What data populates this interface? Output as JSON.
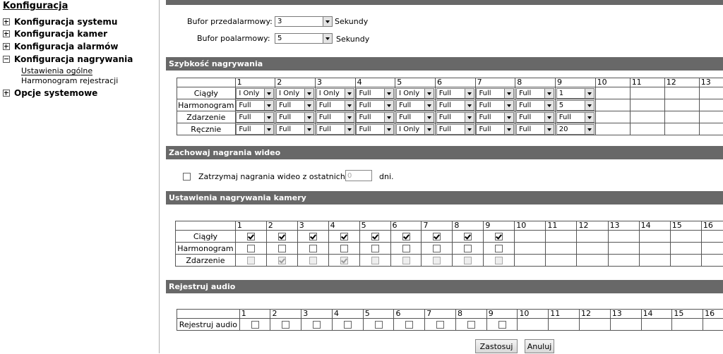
{
  "sidebar": {
    "title": "Konfiguracja",
    "items": [
      {
        "label": "Konfiguracja systemu",
        "expanded": false
      },
      {
        "label": "Konfiguracja kamer",
        "expanded": false
      },
      {
        "label": "Konfiguracja alarmów",
        "expanded": false
      },
      {
        "label": "Konfiguracja nagrywania",
        "expanded": true
      },
      {
        "label": "Opcje systemowe",
        "expanded": false
      }
    ],
    "subitems": [
      "Ustawienia ogólne",
      "Harmonogram rejestracji"
    ]
  },
  "buffer": {
    "pre_label": "Bufor przedalarmowy:",
    "pre_value": "3",
    "post_label": "Bufor poalarmowy:",
    "post_value": "5",
    "unit": "Sekundy"
  },
  "speed": {
    "header": "Szybkość nagrywania",
    "columns": [
      "1",
      "2",
      "3",
      "4",
      "5",
      "6",
      "7",
      "8",
      "9",
      "10",
      "11",
      "12",
      "13"
    ],
    "rows": [
      {
        "label": "Ciągły",
        "values": [
          "I Only",
          "I Only",
          "I Only",
          "Full",
          "I Only",
          "Full",
          "Full",
          "Full",
          "1"
        ]
      },
      {
        "label": "Harmonogram",
        "values": [
          "Full",
          "Full",
          "Full",
          "Full",
          "Full",
          "Full",
          "Full",
          "Full",
          "5"
        ]
      },
      {
        "label": "Zdarzenie",
        "values": [
          "Full",
          "Full",
          "Full",
          "Full",
          "Full",
          "Full",
          "Full",
          "Full",
          "Full"
        ]
      },
      {
        "label": "Ręcznie",
        "values": [
          "Full",
          "Full",
          "Full",
          "Full",
          "I Only",
          "Full",
          "Full",
          "Full",
          "20"
        ]
      }
    ]
  },
  "keep": {
    "header": "Zachowaj nagrania wideo",
    "label": "Zatrzymaj nagrania wideo z ostatnich",
    "value": "0",
    "unit": "dni."
  },
  "camrec": {
    "header": "Ustawienia nagrywania kamery",
    "columns": [
      "1",
      "2",
      "3",
      "4",
      "5",
      "6",
      "7",
      "8",
      "9",
      "10",
      "11",
      "12",
      "13",
      "14",
      "15",
      "16"
    ],
    "rows": [
      {
        "label": "Ciągły",
        "checked": [
          true,
          true,
          true,
          true,
          true,
          true,
          true,
          true,
          true
        ],
        "disabled": [
          false,
          false,
          false,
          false,
          false,
          false,
          false,
          false,
          false
        ]
      },
      {
        "label": "Harmonogram",
        "checked": [
          false,
          false,
          false,
          false,
          false,
          false,
          false,
          false,
          false
        ],
        "disabled": [
          false,
          false,
          false,
          false,
          false,
          false,
          false,
          false,
          false
        ]
      },
      {
        "label": "Zdarzenie",
        "checked": [
          false,
          true,
          false,
          true,
          false,
          false,
          false,
          false,
          false
        ],
        "disabled": [
          true,
          true,
          true,
          true,
          true,
          true,
          true,
          true,
          true
        ]
      }
    ]
  },
  "audio": {
    "header": "Rejestruj audio",
    "columns": [
      "1",
      "2",
      "3",
      "4",
      "5",
      "6",
      "7",
      "8",
      "9",
      "10",
      "11",
      "12",
      "13",
      "14",
      "15",
      "16"
    ],
    "row_label": "Rejestruj audio"
  },
  "buttons": {
    "apply": "Zastosuj",
    "cancel": "Anuluj"
  }
}
